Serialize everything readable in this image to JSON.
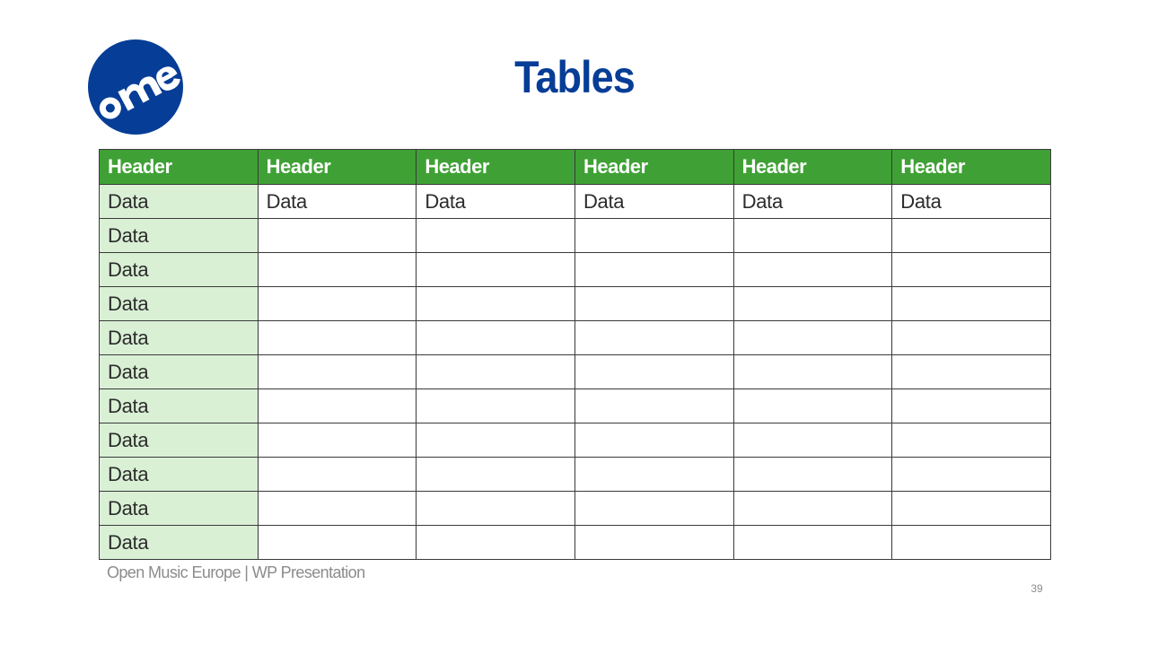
{
  "slide": {
    "title": "Tables",
    "logo": {
      "icon": "ome-logo",
      "text": "ome",
      "color": "#063d96"
    },
    "table": {
      "headers": [
        "Header",
        "Header",
        "Header",
        "Header",
        "Header",
        "Header"
      ],
      "rows": [
        [
          "Data",
          "Data",
          "Data",
          "Data",
          "Data",
          "Data"
        ],
        [
          "Data",
          "",
          "",
          "",
          "",
          ""
        ],
        [
          "Data",
          "",
          "",
          "",
          "",
          ""
        ],
        [
          "Data",
          "",
          "",
          "",
          "",
          ""
        ],
        [
          "Data",
          "",
          "",
          "",
          "",
          ""
        ],
        [
          "Data",
          "",
          "",
          "",
          "",
          ""
        ],
        [
          "Data",
          "",
          "",
          "",
          "",
          ""
        ],
        [
          "Data",
          "",
          "",
          "",
          "",
          ""
        ],
        [
          "Data",
          "",
          "",
          "",
          "",
          ""
        ],
        [
          "Data",
          "",
          "",
          "",
          "",
          ""
        ],
        [
          "Data",
          "",
          "",
          "",
          "",
          ""
        ]
      ],
      "colors": {
        "header_bg": "#3fa135",
        "first_col_bg": "#d9f0d5",
        "border": "#3a3a3a"
      }
    },
    "footer": {
      "text": "Open Music Europe | WP Presentation",
      "page_number": "39"
    }
  }
}
